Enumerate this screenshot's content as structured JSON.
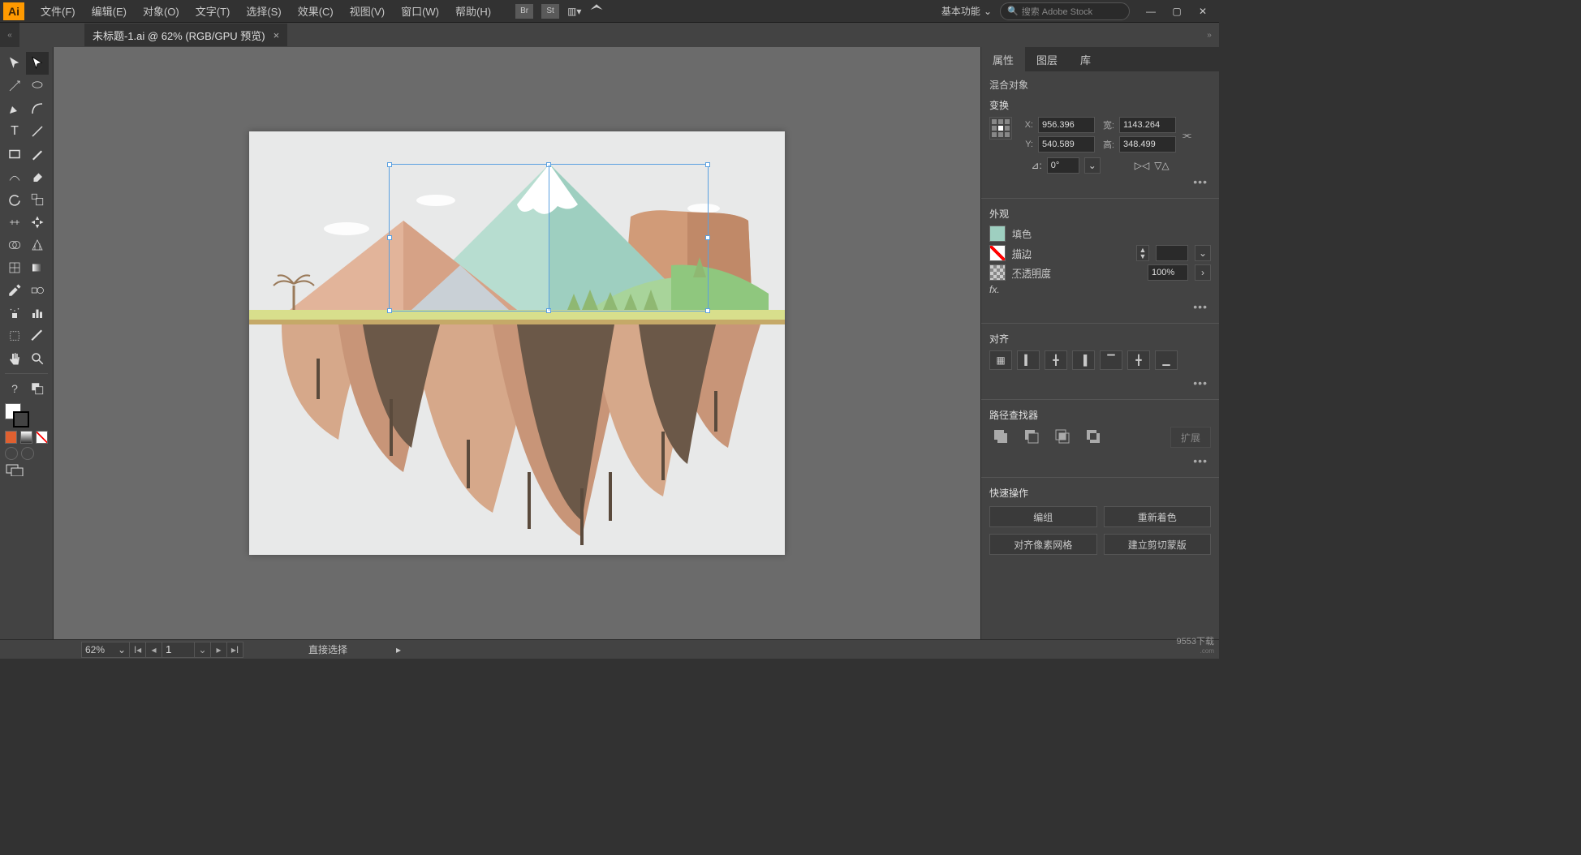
{
  "app": {
    "logo": "Ai",
    "workspace": "基本功能",
    "search_placeholder": "搜索 Adobe Stock"
  },
  "menus": [
    "文件(F)",
    "编辑(E)",
    "对象(O)",
    "文字(T)",
    "选择(S)",
    "效果(C)",
    "视图(V)",
    "窗口(W)",
    "帮助(H)"
  ],
  "doc_tab": {
    "title": "未标题-1.ai @ 62% (RGB/GPU 预览)",
    "close": "×"
  },
  "panels": {
    "tabs": [
      "属性",
      "图层",
      "库"
    ],
    "object_label": "混合对象",
    "transform": {
      "title": "变换",
      "x_label": "X:",
      "x": "956.396",
      "y_label": "Y:",
      "y": "540.589",
      "w_label": "宽:",
      "w": "1143.264",
      "h_label": "高:",
      "h": "348.499",
      "angle_label": "⊿:",
      "angle": "0°"
    },
    "appearance": {
      "title": "外观",
      "fill": "填色",
      "stroke": "描边",
      "opacity_label": "不透明度",
      "opacity": "100%",
      "fx": "fx."
    },
    "align": {
      "title": "对齐"
    },
    "pathfinder": {
      "title": "路径查找器",
      "expand": "扩展"
    },
    "quick": {
      "title": "快速操作",
      "btn1": "编组",
      "btn2": "重新着色",
      "btn3": "对齐像素网格",
      "btn4": "建立剪切蒙版"
    }
  },
  "status": {
    "zoom": "62%",
    "page": "1",
    "tool": "直接选择"
  },
  "watermark": {
    "line1": "9553下载",
    "line2": ".com"
  }
}
